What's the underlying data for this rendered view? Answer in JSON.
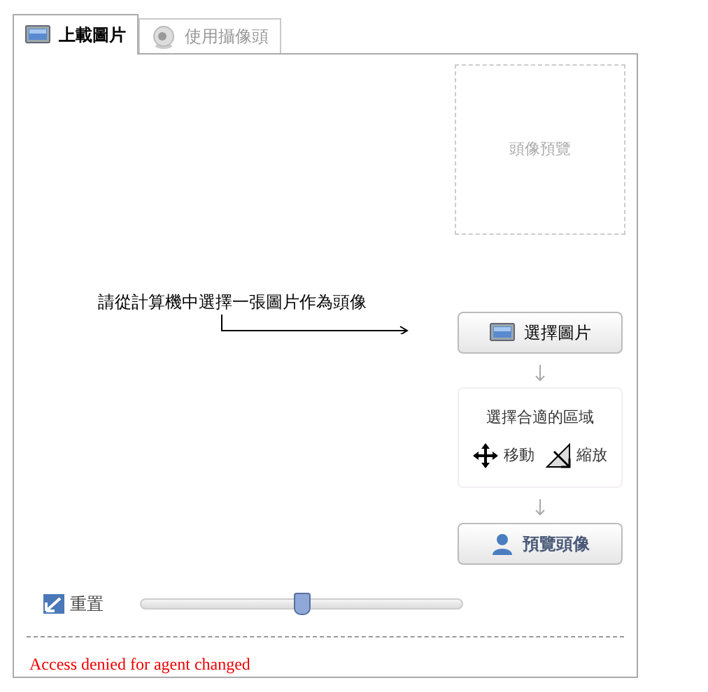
{
  "tabs": [
    {
      "label": "上載圖片",
      "kind": "monitor",
      "selected": true
    },
    {
      "label": "使用攝像頭",
      "kind": "webcam",
      "selected": false
    }
  ],
  "preview": {
    "placeholder": "頭像預覽"
  },
  "instruction": "請從計算機中選擇一張圖片作為頭像",
  "select_button": "選擇圖片",
  "crop_step": {
    "title": "選擇合適的區域",
    "actions": [
      {
        "kind": "move",
        "label": "移動"
      },
      {
        "kind": "resize",
        "label": "縮放"
      }
    ]
  },
  "preview_button": "預覽頭像",
  "reset": "重置",
  "zoom_slider": {
    "level": 0.5
  },
  "error": "Access denied for agent changed"
}
